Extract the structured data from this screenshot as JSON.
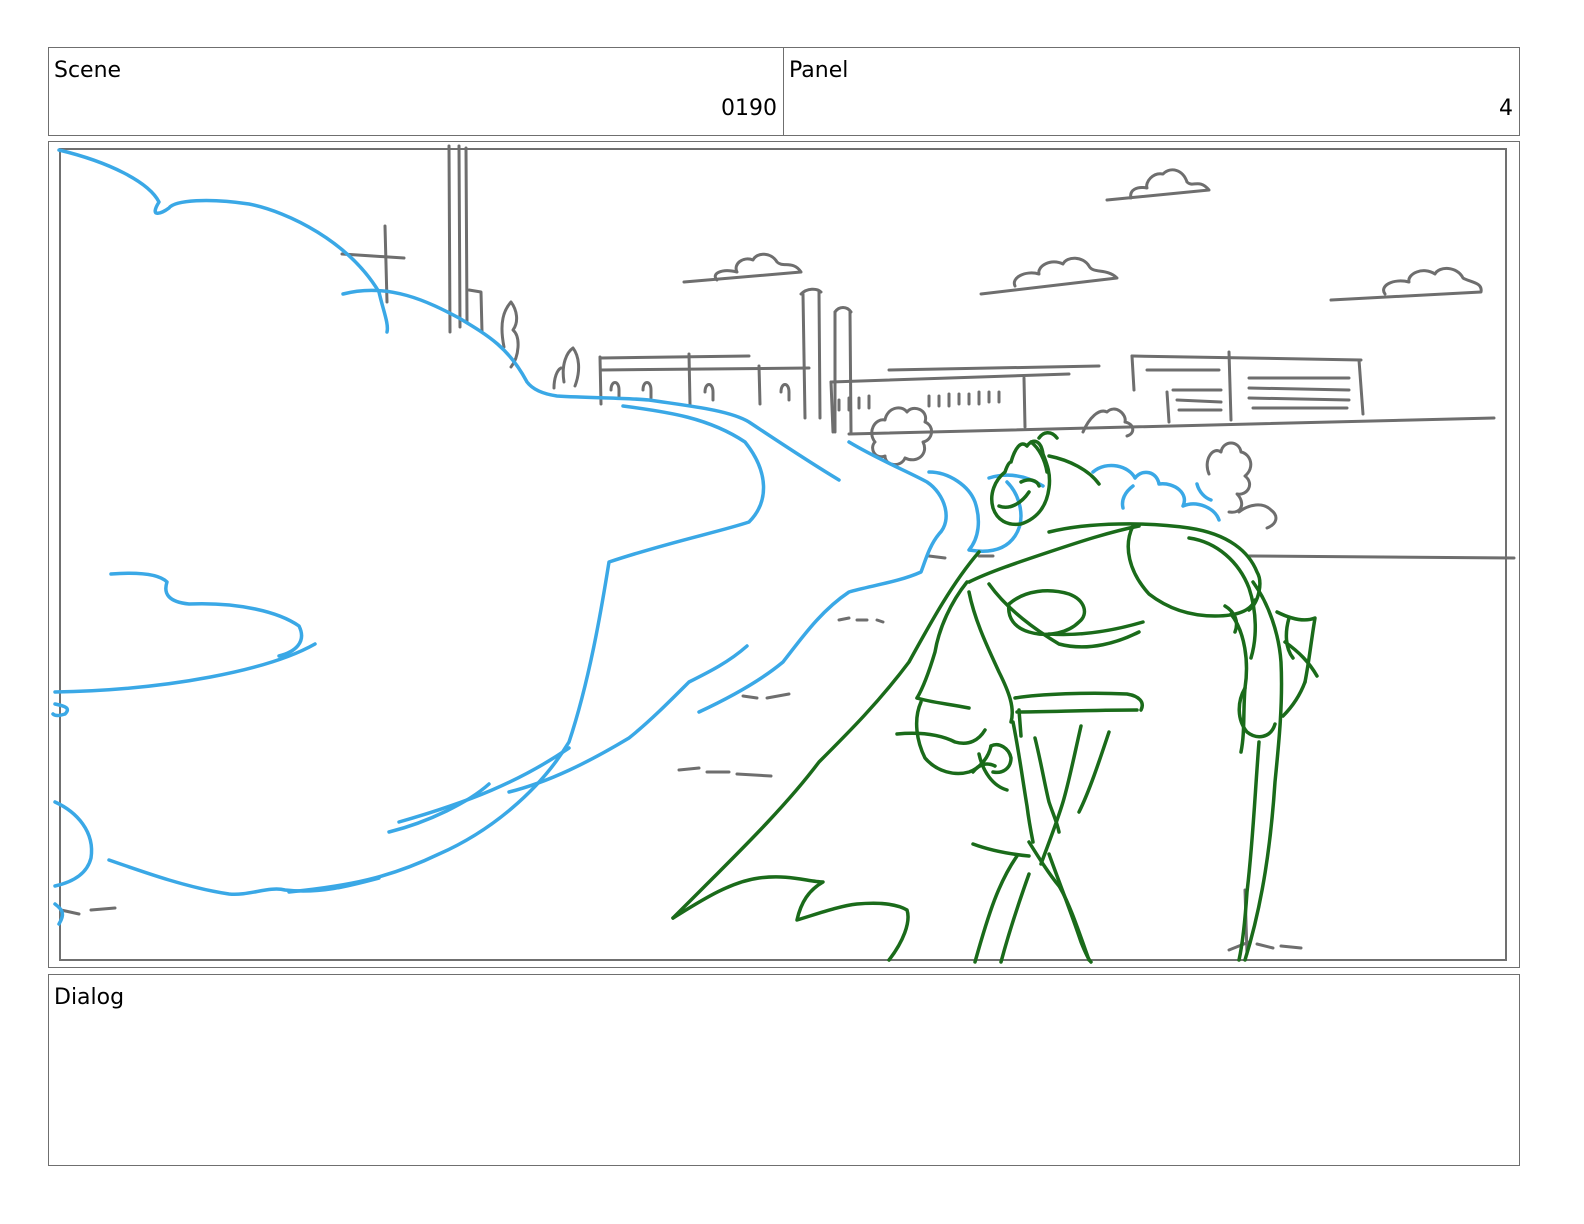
{
  "scene": {
    "label": "Scene",
    "value": "0190"
  },
  "panel": {
    "label": "Panel",
    "value": "4"
  },
  "dialog": {
    "label": "Dialog",
    "text": ""
  },
  "sketch": {
    "background_line_color": "#6e6e6e",
    "smoke_color": "#3aa8e6",
    "character_color": "#1a6b1a"
  }
}
